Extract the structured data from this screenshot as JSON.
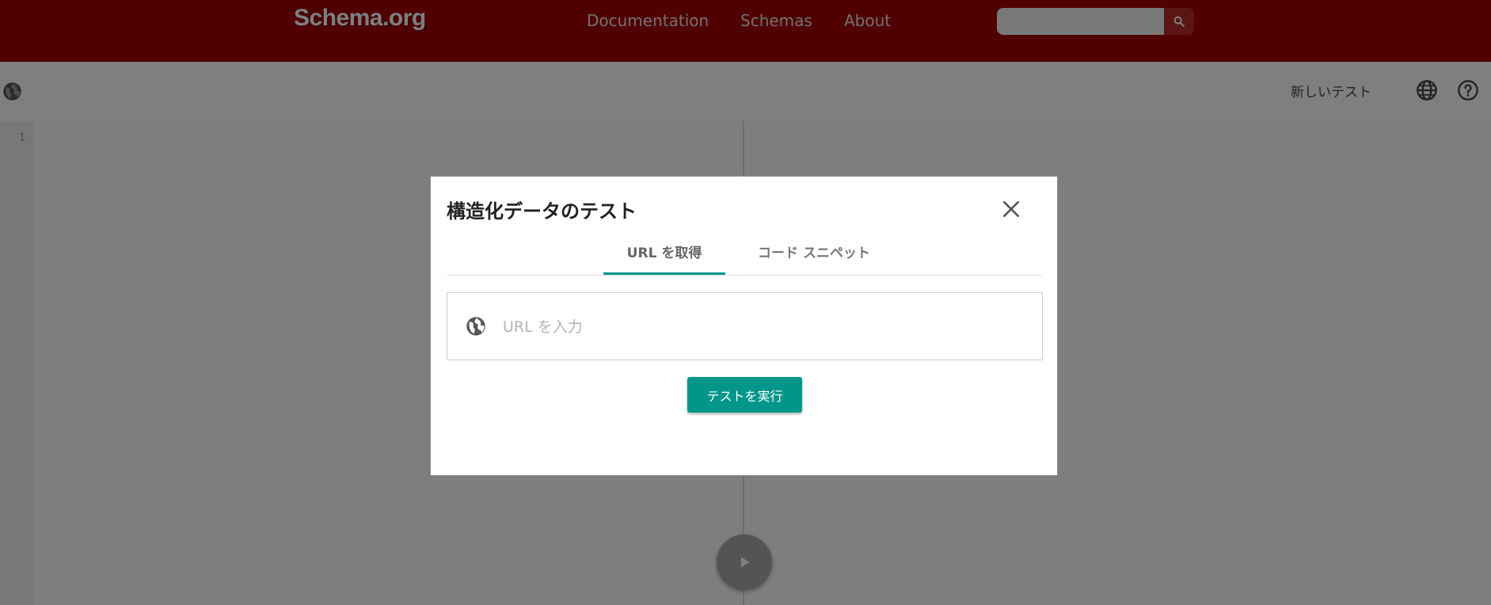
{
  "header": {
    "logo": "Schema.org",
    "nav": [
      "Documentation",
      "Schemas",
      "About"
    ],
    "search": {
      "placeholder": "",
      "icon": "search-icon"
    },
    "color": "#a00000"
  },
  "toolbar": {
    "new_test_label": "新しいテスト",
    "icons": [
      "globe-icon",
      "language-icon",
      "help-icon"
    ]
  },
  "editor": {
    "line_numbers": [
      "1"
    ]
  },
  "dialog": {
    "title": "構造化データのテスト",
    "tabs": [
      {
        "label": "URL を取得",
        "active": true
      },
      {
        "label": "コード スニペット",
        "active": false
      }
    ],
    "url_input": {
      "placeholder": "URL を入力",
      "value": ""
    },
    "run_button_label": "テストを実行",
    "accent_color": "#00968a"
  }
}
